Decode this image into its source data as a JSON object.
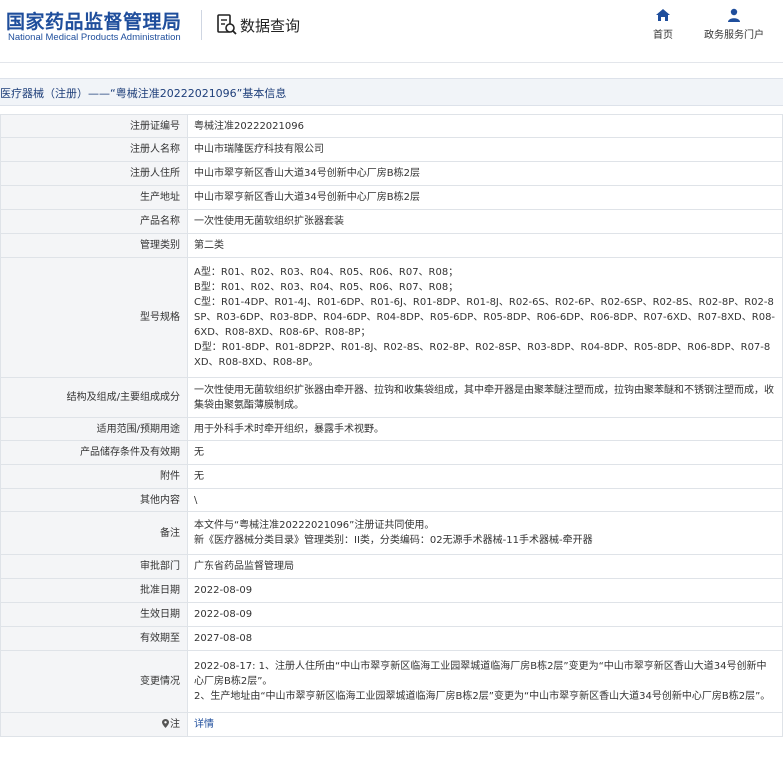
{
  "header": {
    "logo_cn": "国家药品监督管理局",
    "logo_en": "National Medical Products Administration",
    "query_label": "数据查询",
    "query_icon": "search-document-icon",
    "nav": [
      {
        "label": "首页",
        "icon": "home-icon"
      },
      {
        "label": "政务服务门户",
        "icon": "user-icon"
      }
    ],
    "brand_color": "#1f4e9c"
  },
  "title": "医疗器械（注册）——“粤械注准20222021096”基本信息",
  "rows": [
    {
      "label": "注册证编号",
      "lines": [
        "粤械注准20222021096"
      ]
    },
    {
      "label": "注册人名称",
      "lines": [
        "中山市瑞隆医疗科技有限公司"
      ]
    },
    {
      "label": "注册人住所",
      "lines": [
        "中山市翠亨新区香山大道34号创新中心厂房B栋2层"
      ]
    },
    {
      "label": "生产地址",
      "lines": [
        "中山市翠亨新区香山大道34号创新中心厂房B栋2层"
      ]
    },
    {
      "label": "产品名称",
      "lines": [
        "一次性使用无菌软组织扩张器套装"
      ]
    },
    {
      "label": "管理类别",
      "lines": [
        "第二类"
      ]
    },
    {
      "label": "型号规格",
      "lines": [
        "A型：R01、R02、R03、R04、R05、R06、R07、R08；",
        "B型：R01、R02、R03、R04、R05、R06、R07、R08；",
        "C型：R01-4DP、R01-4J、R01-6DP、R01-6J、R01-8DP、R01-8J、R02-6S、R02-6P、R02-6SP、R02-8S、R02-8P、R02-8SP、R03-6DP、R03-8DP、R04-6DP、R04-8DP、R05-6DP、R05-8DP、R06-6DP、R06-8DP、R07-6XD、R07-8XD、R08-6XD、R08-8XD、R08-6P、R08-8P；",
        "D型：R01-8DP、R01-8DP2P、R01-8J、R02-8S、R02-8P、R02-8SP、R03-8DP、R04-8DP、R05-8DP、R06-8DP、R07-8XD、R08-8XD、R08-8P。"
      ]
    },
    {
      "label": "结构及组成/主要组成成分",
      "lines": [
        "一次性使用无菌软组织扩张器由牵开器、拉钩和收集袋组成，其中牵开器是由聚苯醚注塑而成，拉钩由聚苯醚和不锈钢注塑而成，收集袋由聚氨酯薄膜制成。"
      ]
    },
    {
      "label": "适用范围/预期用途",
      "lines": [
        "用于外科手术时牵开组织，暴露手术视野。"
      ]
    },
    {
      "label": "产品储存条件及有效期",
      "lines": [
        "无"
      ]
    },
    {
      "label": "附件",
      "lines": [
        "无"
      ]
    },
    {
      "label": "其他内容",
      "lines": [
        "\\"
      ]
    },
    {
      "label": "备注",
      "lines": [
        "本文件与“粤械注准20222021096”注册证共同使用。",
        "新《医疗器械分类目录》管理类别：II类，分类编码：02无源手术器械-11手术器械-牵开器"
      ]
    },
    {
      "label": "审批部门",
      "lines": [
        "广东省药品监督管理局"
      ]
    },
    {
      "label": "批准日期",
      "lines": [
        "2022-08-09"
      ]
    },
    {
      "label": "生效日期",
      "lines": [
        "2022-08-09"
      ]
    },
    {
      "label": "有效期至",
      "lines": [
        "2027-08-08"
      ]
    },
    {
      "label": "变更情况",
      "lines": [
        "2022-08-17: 1、注册人住所由“中山市翠亨新区临海工业园翠城道临海厂房B栋2层”变更为“中山市翠亨新区香山大道34号创新中心厂房B栋2层”。",
        "2、生产地址由“中山市翠亨新区临海工业园翠城道临海厂房B栋2层”变更为“中山市翠亨新区香山大道34号创新中心厂房B栋2层”。"
      ]
    }
  ],
  "note": {
    "label": "注",
    "link": "详情",
    "icon": "location-pin-icon"
  }
}
